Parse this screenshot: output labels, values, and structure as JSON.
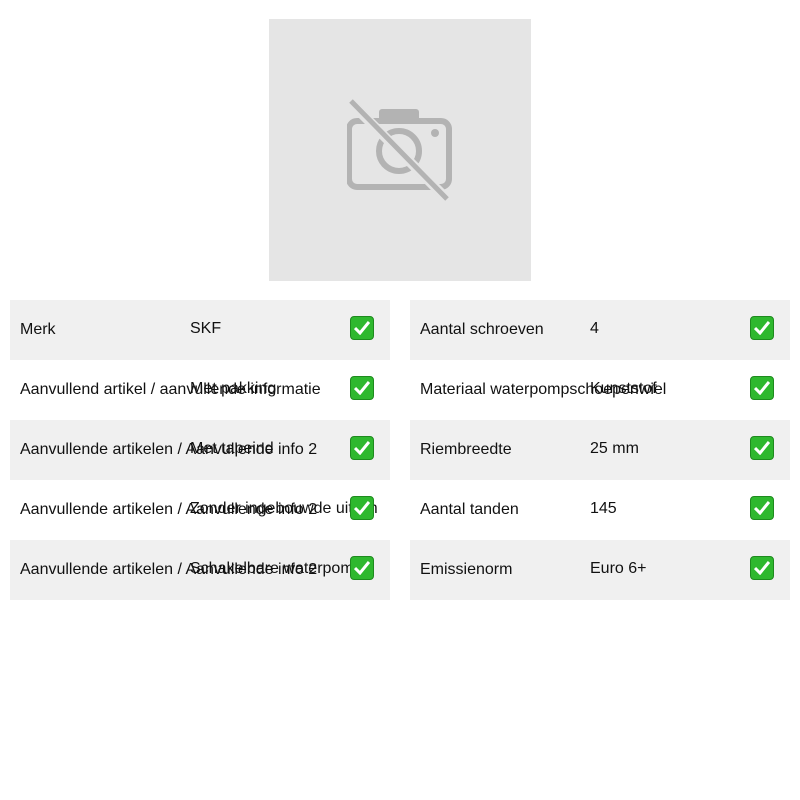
{
  "image": {
    "icon": "camera-off-icon"
  },
  "specs_left": [
    {
      "label": "Merk",
      "value": "SKF"
    },
    {
      "label": "Aanvullend artikel / aanvullende informatie",
      "value": "Met pakking"
    },
    {
      "label": "Aanvullende artikelen / Aanvullende info 2",
      "value": "Met tapeind"
    },
    {
      "label": "Aanvullende artikelen / Aanvullende info 2",
      "value": "Zonder ingebouwde uitsch"
    },
    {
      "label": "Aanvullende artikelen / Aanvullende info 2",
      "value": "Schakelbare waterpomp"
    }
  ],
  "specs_right": [
    {
      "label": "Aantal schroeven",
      "value": "4"
    },
    {
      "label": "Materiaal waterpompschoepenwiel",
      "value": "Kunststof"
    },
    {
      "label": "Riembreedte",
      "value": "25 mm"
    },
    {
      "label": "Aantal tanden",
      "value": "145"
    },
    {
      "label": "Emissienorm",
      "value": "Euro 6+"
    }
  ],
  "colors": {
    "check_green": "#2eb82e",
    "row_shade": "#f0f0f0",
    "placeholder_bg": "#e5e5e5"
  }
}
